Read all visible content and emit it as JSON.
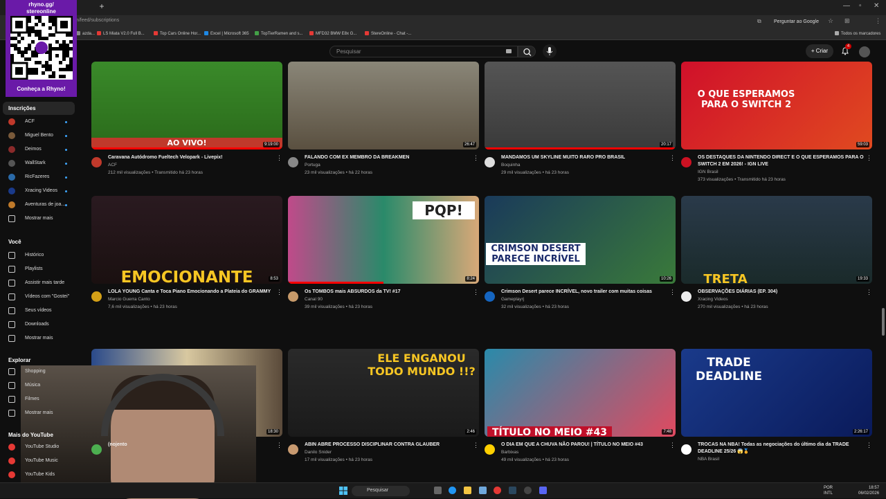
{
  "browser": {
    "url": "m/feed/subscriptions",
    "google_btn": "Perguntar ao Google",
    "bookmarks": [
      {
        "label": "azda...",
        "color": "#888888"
      },
      {
        "label": "LS Miata V2.0 Full B...",
        "color": "#e53935"
      },
      {
        "label": "Top Cars Online Hor...",
        "color": "#e53935"
      },
      {
        "label": "Excel | Microsoft 365",
        "color": "#1e88e5"
      },
      {
        "label": "TopTierRamen and s...",
        "color": "#43a047"
      },
      {
        "label": "MFD32 BMW E8x G...",
        "color": "#e53935"
      },
      {
        "label": "StereOnline - Chat -...",
        "color": "#e53935"
      }
    ],
    "all_bookmarks": "Todos os marcadores"
  },
  "promo": {
    "top": "rhyno.gg/\nstereonline",
    "bottom": "Conheça a Rhyno!"
  },
  "header": {
    "search_placeholder": "Pesquisar",
    "create_label": "Criar",
    "notif_count": "4"
  },
  "sidebar": {
    "subs_title": "Inscrições",
    "subs": [
      {
        "label": "ACF",
        "color": "#c0392b"
      },
      {
        "label": "Miguel Bento",
        "color": "#7a5a3a"
      },
      {
        "label": "Deimos",
        "color": "#8a2a2a"
      },
      {
        "label": "WallStark",
        "color": "#555555"
      },
      {
        "label": "RicFazeres",
        "color": "#2a6aa8"
      },
      {
        "label": "Xracing Videos",
        "color": "#1a3a8a"
      },
      {
        "label": "Aventuras de joa...",
        "color": "#c07a2a"
      }
    ],
    "subs_more": "Mostrar mais",
    "you_title": "Você",
    "you_items": [
      "Histórico",
      "Playlists",
      "Assistir mais tarde",
      "Vídeos com \"Gostei\"",
      "Seus vídeos",
      "Downloads",
      "Mostrar mais"
    ],
    "explore_title": "Explorar",
    "explore_items": [
      "Shopping",
      "Música",
      "Filmes",
      "Mostrar mais"
    ],
    "more_title": "Mais do YouTube",
    "more_items": [
      "YouTube Studio",
      "YouTube Music",
      "YouTube Kids"
    ]
  },
  "videos": [
    {
      "title": "Caravana Autódromo Fueltech Velopark - Livepix!",
      "channel": "ACF",
      "meta": "212 mil visualizações • Transmitido há 23 horas",
      "duration": "9:19:00",
      "overlay": "AO VIVO!",
      "av": "#c0392b",
      "progress": 1.0
    },
    {
      "title": "FALANDO COM EX MEMBRO DA BREAKMEN",
      "channel": "Portuga",
      "meta": "23 mil visualizações • há 22 horas",
      "duration": "26:47",
      "overlay": "",
      "av": "#888888",
      "progress": 0
    },
    {
      "title": "MANDAMOS UM SKYLINE MUITO RARO PRO BRASIL",
      "channel": "Boquinha",
      "meta": "29 mil visualizações • há 23 horas",
      "duration": "20:17",
      "overlay": "",
      "av": "#dddddd",
      "progress": 1.0
    },
    {
      "title": "OS DESTAQUES DA NINTENDO DIRECT E O QUE ESPERAMOS PARA O SWITCH 2 EM 2026! - IGN LIVE",
      "channel": "IGN Brasil",
      "meta": "373 visualizações • Transmitido há 23 horas",
      "duration": "59:03",
      "overlay": "O QUE ESPERAMOS PARA O SWITCH 2",
      "av": "#cc1122",
      "progress": 0
    },
    {
      "title": "LOLA YOUNG Canta e Toca Piano Emocionando a Plateia do GRAMMY",
      "channel": "Marcio Guerra Canto",
      "meta": "7,6 mil visualizações • há 23 horas",
      "duration": "8:53",
      "overlay": "EMOCIONANTE",
      "av": "#d4a017",
      "progress": 0
    },
    {
      "title": "Os TOMBOS mais ABSURDOS da TV! #17",
      "channel": "Canal 90",
      "meta": "39 mil visualizações • há 23 horas",
      "duration": "8:24",
      "overlay": "PQP!",
      "av": "#c79a6a",
      "progress": 0.5
    },
    {
      "title": "Crimson Desert parece INCRÍVEL, novo trailer com muitas coisas",
      "channel": "Gameplayrj",
      "meta": "32 mil visualizações • há 23 horas",
      "duration": "10:26",
      "overlay": "CRIMSON DESERT PARECE INCRÍVEL",
      "av": "#1565c0",
      "progress": 0
    },
    {
      "title": "OBSERVAÇÕES DIÁRIAS (EP. 304)",
      "channel": "Xracing Videos",
      "meta": "270 mil visualizações • há 23 horas",
      "duration": "19:33",
      "overlay": "TRETA",
      "av": "#eeeeee",
      "progress": 0
    },
    {
      "title": "(nojento",
      "channel": "",
      "meta": "",
      "duration": "18:30",
      "overlay": "",
      "av": "#4caf50",
      "progress": 0
    },
    {
      "title": "ABIN ABRE PROCESSO DISCIPLINAR CONTRA GLAUBER",
      "channel": "Danilo Snider",
      "meta": "17 mil visualizações • há 23 horas",
      "duration": "2:46",
      "overlay": "ELE ENGANOU TODO MUNDO !!?",
      "av": "#c89a70",
      "progress": 0
    },
    {
      "title": "O DIA EM QUE A CHUVA NÃO PAROU! | TÍTULO NO MEIO #43",
      "channel": "Barbixas",
      "meta": "49 mil visualizações • há 23 horas",
      "duration": "7:48",
      "overlay": "TÍTULO NO MEIO #43",
      "av": "#ffd000",
      "progress": 0
    },
    {
      "title": "TROCAS NA NBA! Todas as negociações do último dia da TRADE DEADLINE 25/26 😱🏅",
      "channel": "NBA Brasil",
      "meta": "",
      "duration": "2:26:17",
      "overlay": "TRADE DEADLINE",
      "av": "#ffffff",
      "progress": 0
    }
  ],
  "taskbar": {
    "search": "Pesquisar",
    "lang": "POR\nINTL",
    "time": "18:57",
    "date": "06/02/2026"
  }
}
